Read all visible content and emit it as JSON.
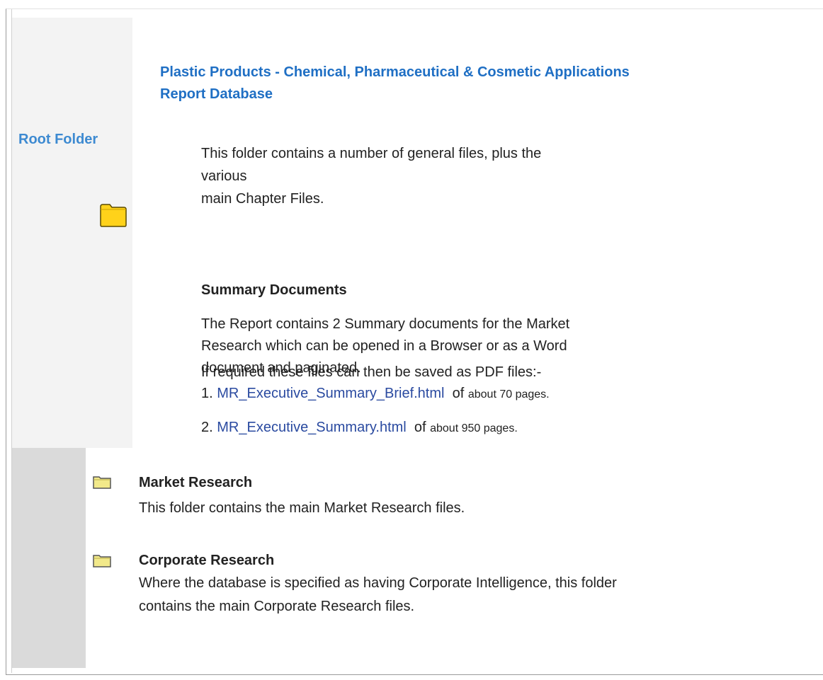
{
  "sidebar": {
    "label": "Root Folder"
  },
  "header": {
    "title_line1": "Plastic Products - Chemical, Pharmaceutical & Cosmetic Applications",
    "title_line2": "Report Database"
  },
  "intro": {
    "line1": "This folder contains a number of general files, plus the various",
    "line2": "main Chapter Files."
  },
  "summary": {
    "heading": "Summary Documents",
    "body_line1": "The Report contains 2 Summary documents for the Market",
    "body_line2": "Research which can be opened in a Browser or as a Word",
    "body_line3": "document and paginated.",
    "pdf_note": "If required these files can then be saved as PDF files:-",
    "items": [
      {
        "number": "1.",
        "link": "MR_Executive_Summary_Brief.html",
        "of": "of",
        "pages": "about 70 pages."
      },
      {
        "number": "2.",
        "link": "MR_Executive_Summary.html",
        "of": "of",
        "pages": "about 950 pages."
      }
    ]
  },
  "sections": [
    {
      "title": "Market Research",
      "body": "This folder contains the main Market Research files."
    },
    {
      "title": "Corporate Research",
      "body_line1": "Where the database is specified as having Corporate Intelligence, this folder",
      "body_line2": "contains the main Corporate Research files."
    }
  ],
  "colors": {
    "sidebar_label": "#3d8ad1",
    "title": "#1f6fc4",
    "link": "#2a4aa0",
    "folder_fill": "#ffd21a",
    "folder_small_fill": "#f2e98a"
  },
  "icons": {
    "root_folder": "folder-icon",
    "section_folder": "folder-icon"
  }
}
